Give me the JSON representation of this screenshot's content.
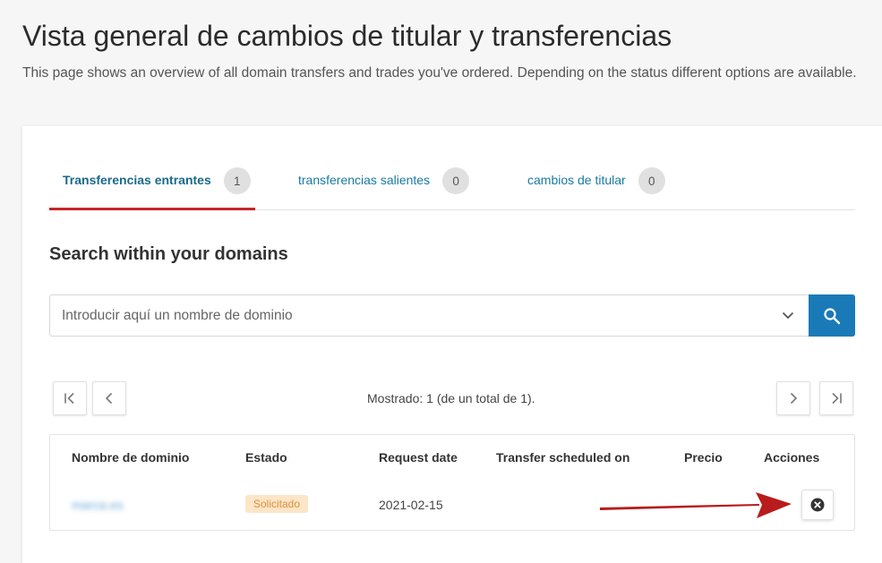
{
  "page": {
    "title": "Vista general de cambios de titular y transferencias",
    "description": "This page shows an overview of all domain transfers and trades you've ordered. Depending on the status different options are available."
  },
  "tabs": [
    {
      "label": "Transferencias entrantes",
      "count": "1",
      "active": true
    },
    {
      "label": "transferencias salientes",
      "count": "0",
      "active": false
    },
    {
      "label": "cambios de titular",
      "count": "0",
      "active": false
    }
  ],
  "search": {
    "title": "Search within your domains",
    "placeholder": "Introducir aquí un nombre de dominio"
  },
  "pagination": {
    "text": "Mostrado: 1 (de un total de 1)."
  },
  "table": {
    "headers": [
      "Nombre de dominio",
      "Estado",
      "Request date",
      "Transfer scheduled on",
      "Precio",
      "Acciones"
    ],
    "rows": [
      {
        "domain": "marca.es",
        "status": "Solicitado",
        "request_date": "2021-02-15",
        "scheduled_on": "",
        "price": ""
      }
    ]
  },
  "colors": {
    "accent": "#1a7ab8",
    "active_tab_underline": "#c8252c",
    "arrow": "#b81c1c",
    "badge_bg": "#fde5c8",
    "badge_text": "#d9923a"
  },
  "icons": [
    "first-page-icon",
    "prev-page-icon",
    "next-page-icon",
    "last-page-icon",
    "search-icon",
    "chevron-down-icon",
    "cancel-circle-icon"
  ]
}
